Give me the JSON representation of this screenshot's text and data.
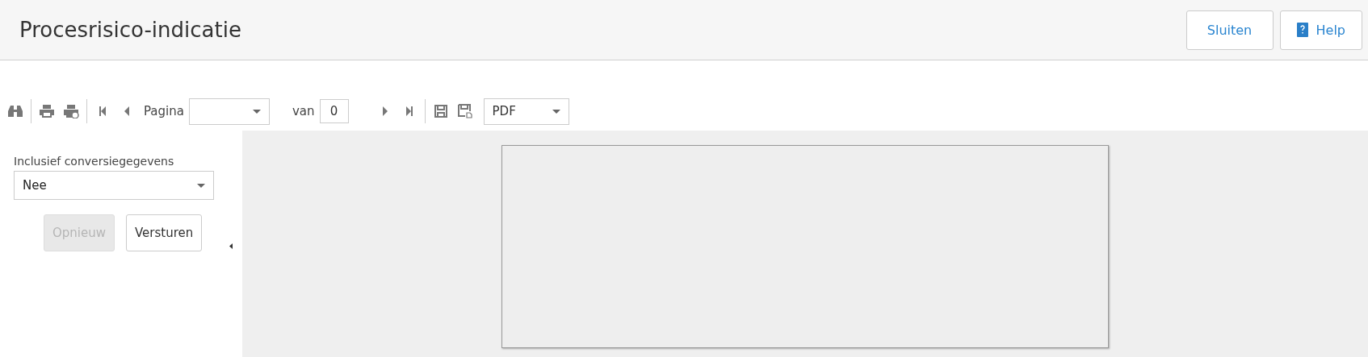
{
  "header": {
    "title": "Procesrisico-indicatie",
    "buttons": [
      {
        "label": "Sluiten",
        "kind": "plain"
      },
      {
        "label": "Help",
        "kind": "help"
      }
    ]
  },
  "toolbar": {
    "page_label": "Pagina",
    "of_label": "van",
    "page_count": "0",
    "format": "PDF"
  },
  "parameters": {
    "label": "Inclusief conversiegegevens",
    "value": "Nee",
    "buttons": [
      {
        "label": "Opnieuw",
        "disabled": true
      },
      {
        "label": "Versturen",
        "disabled": false
      }
    ]
  }
}
